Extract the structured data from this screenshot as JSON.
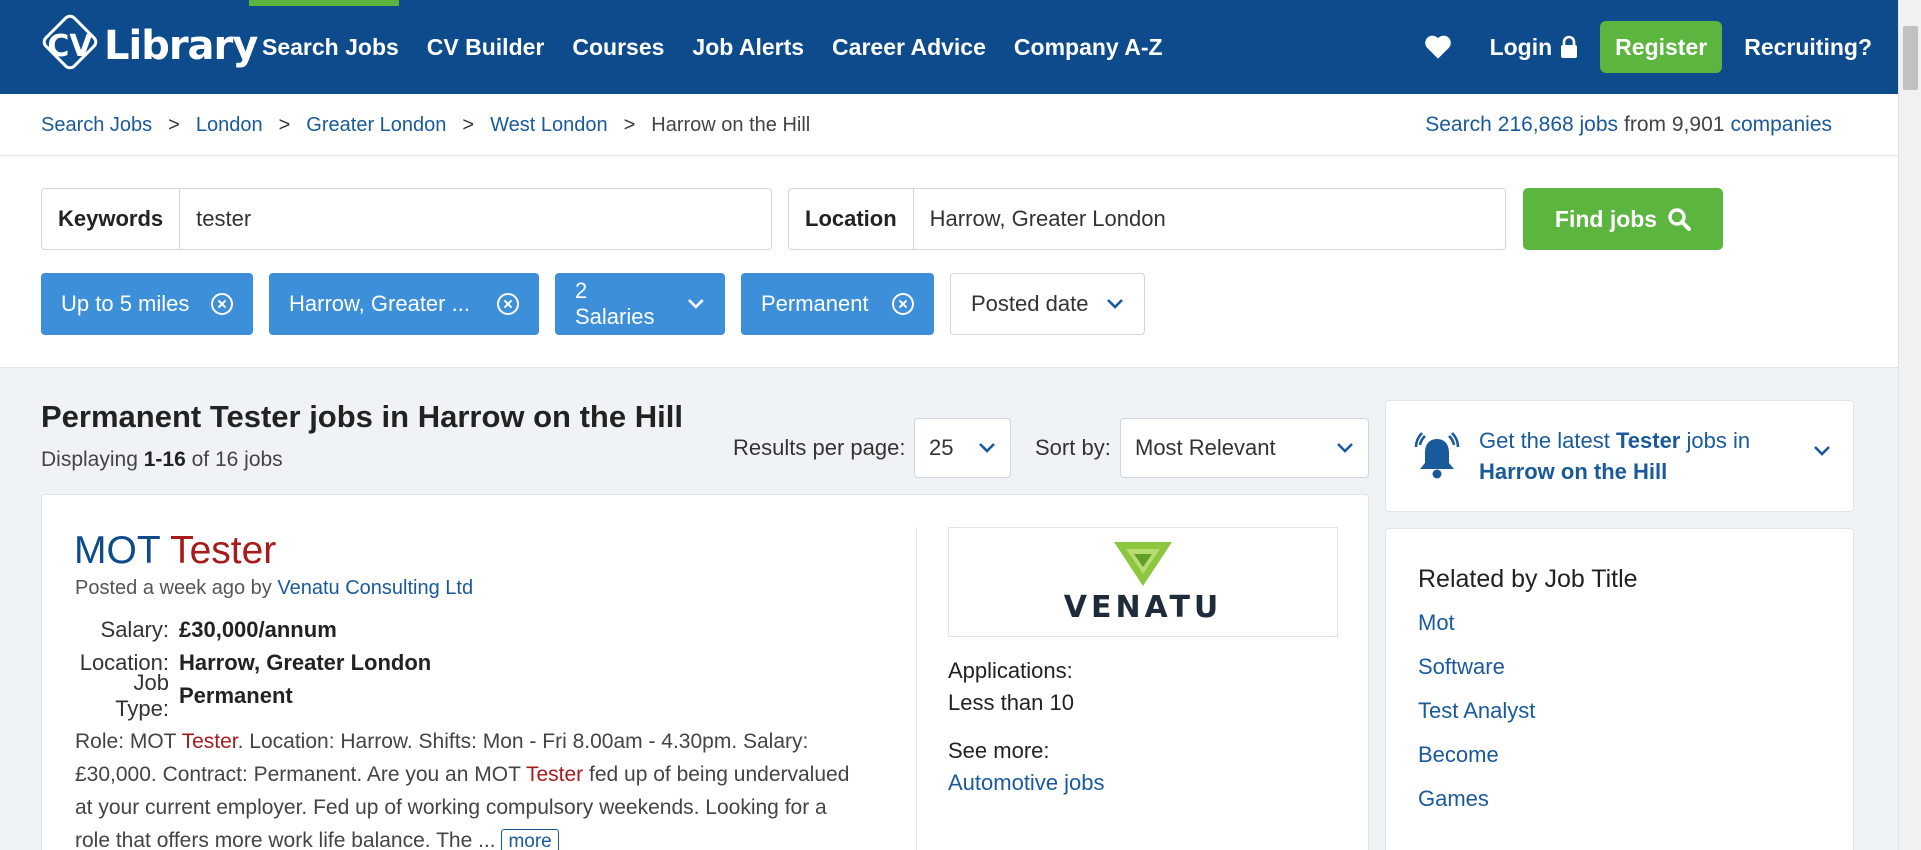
{
  "header": {
    "logo_text": "CVLibrary",
    "logo_cv": "CV",
    "logo_word": "Library",
    "nav": [
      "Search Jobs",
      "CV Builder",
      "Courses",
      "Job Alerts",
      "Career Advice",
      "Company A-Z"
    ],
    "login_label": "Login",
    "register_label": "Register",
    "recruiting_label": "Recruiting?",
    "icons": {
      "favourite": "heart-icon",
      "login": "lock-icon"
    },
    "colors": {
      "bar": "#0d4b8d",
      "accent": "#5bb53e"
    }
  },
  "breadcrumb": {
    "items": [
      "Search Jobs",
      "London",
      "Greater London",
      "West London"
    ],
    "current": "Harrow on the Hill",
    "separator": ">"
  },
  "stats": {
    "prefix": "Search",
    "jobs": "216,868 jobs",
    "middle": "from 9,901",
    "companies": "companies"
  },
  "search": {
    "keywords_label": "Keywords",
    "keywords_value": "tester",
    "location_label": "Location",
    "location_value": "Harrow, Greater London",
    "find_label": "Find jobs"
  },
  "filters": {
    "distance": "Up to 5 miles",
    "location": "Harrow, Greater ...",
    "salaries": "2 Salaries",
    "job_type": "Permanent",
    "posted": "Posted date"
  },
  "results": {
    "title": "Permanent Tester jobs in Harrow on the Hill",
    "count_prefix": "Displaying",
    "count_range": "1-16",
    "count_suffix": "of 16 jobs",
    "per_page_label": "Results per page:",
    "per_page_value": "25",
    "sort_label": "Sort by:",
    "sort_value": "Most Relevant"
  },
  "job": {
    "title_word1": "MOT",
    "title_word2": "Tester",
    "posted_prefix": "Posted a week ago by",
    "company": "Venatu Consulting Ltd",
    "salary_label": "Salary:",
    "salary_value": "£30,000/annum",
    "location_label": "Location:",
    "location_value": "Harrow, Greater London",
    "type_label": "Job Type:",
    "type_value": "Permanent",
    "desc_1": "Role: MOT ",
    "desc_hl1": "Tester",
    "desc_2": ". Location: Harrow. Shifts: Mon - Fri 8.00am - 4.30pm. Salary: £30,000. Contract: Permanent. Are you an MOT ",
    "desc_hl2": "Tester",
    "desc_3": " fed up of being undervalued at your current employer. Fed up of working compulsory weekends. Looking for a role that offers more work life balance. The ... ",
    "more_label": "more",
    "logo_word": "VENATU",
    "applications_label": "Applications:",
    "applications_value": "Less than 10",
    "see_more_label": "See more:",
    "see_more_link": "Automotive jobs"
  },
  "alert": {
    "text_1": "Get the latest ",
    "text_bold": "Tester",
    "text_2": " jobs in",
    "location": "Harrow on the Hill",
    "icon": "bell-icon"
  },
  "related": {
    "heading": "Related by Job Title",
    "items": [
      "Mot",
      "Software",
      "Test Analyst",
      "Become",
      "Games"
    ]
  }
}
